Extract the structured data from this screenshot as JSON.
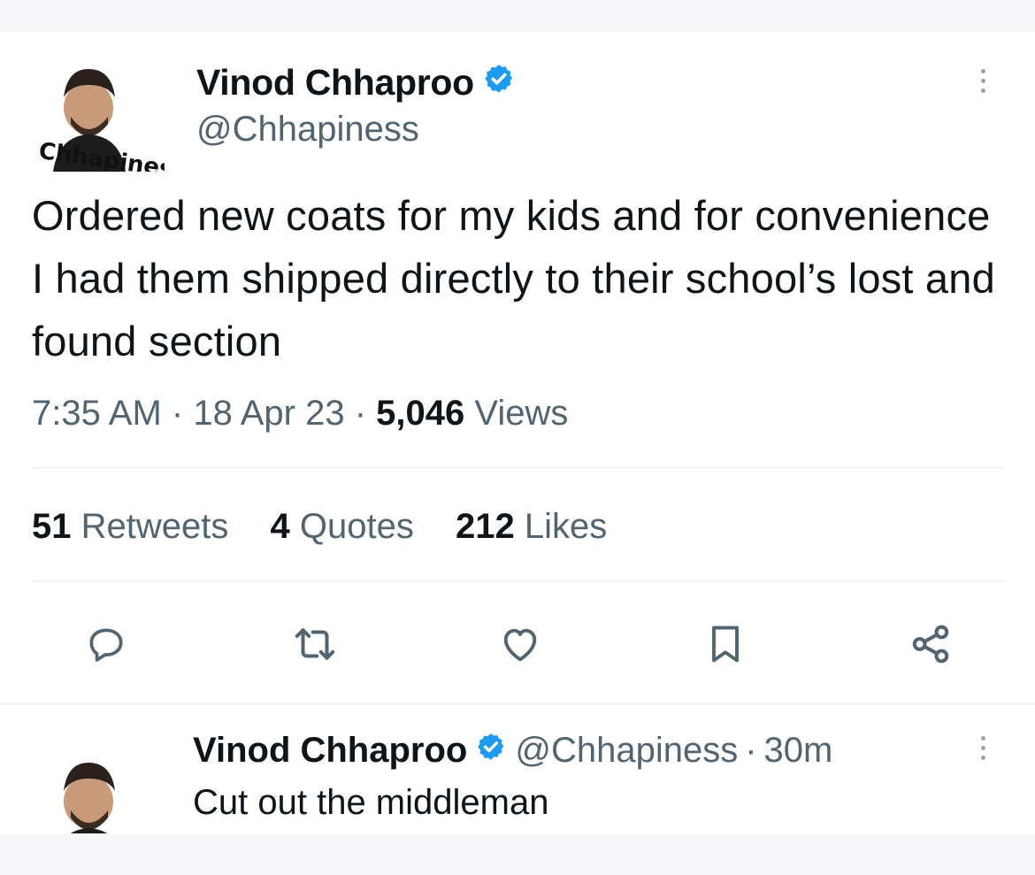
{
  "tweet": {
    "author_name": "Vinod Chhaproo",
    "author_handle": "@Chhapiness",
    "text": "Ordered new coats for my kids and for convenience I had them shipped directly to their school’s lost and found section",
    "time": "7:35 AM",
    "date": "18 Apr 23",
    "views_count": "5,046",
    "views_label": "Views",
    "separator": "·",
    "retweets_count": "51",
    "retweets_label": "Retweets",
    "quotes_count": "4",
    "quotes_label": "Quotes",
    "likes_count": "212",
    "likes_label": "Likes",
    "avatar_text": "Chhapiness",
    "icons": {
      "verified": "verified-badge-icon",
      "more": "more-vertical-icon",
      "reply": "reply-icon",
      "retweet": "retweet-icon",
      "like": "heart-icon",
      "bookmark": "bookmark-icon",
      "share": "share-icon"
    }
  },
  "reply": {
    "author_name": "Vinod Chhaproo",
    "author_handle": "@Chhapiness",
    "separator": "·",
    "age": "30m",
    "text": "Cut out the middleman"
  },
  "colors": {
    "verified": "#1d9bf0",
    "text": "#0f1419",
    "secondary": "#536471",
    "divider": "#eff3f4"
  }
}
